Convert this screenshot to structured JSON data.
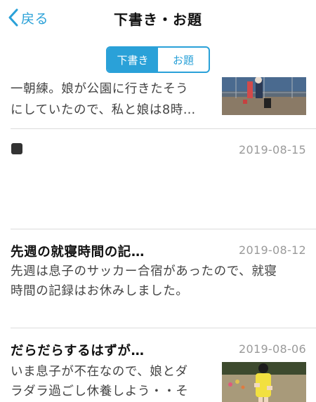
{
  "nav": {
    "back_label": "戻る",
    "title": "下書き・お題"
  },
  "segment": {
    "tabs": [
      "下書き",
      "お題"
    ],
    "selected": "下書き"
  },
  "list": [
    {
      "title": "",
      "date": "",
      "excerpt_lines": [
        "一朝練。娘が公園に行きたそう",
        "にしていたので、私と娘は8時…"
      ],
      "has_thumbnail": true
    },
    {
      "title": "",
      "date": "2019-08-15",
      "excerpt_lines": [],
      "icon": "black-square-icon"
    },
    {
      "title": "先週の就寝時間の記…",
      "date": "2019-08-12",
      "excerpt_lines": [
        "先週は息子のサッカー合宿があったので、就寝",
        "時間の記録はお休みしました。"
      ],
      "has_thumbnail": false
    },
    {
      "title": "だらだらするはずが…",
      "date": "2019-08-06",
      "excerpt_lines": [
        "いま息子が不在なので、娘とダ",
        "ラダラ過ごし休養しよう・・そ"
      ],
      "has_thumbnail": true
    }
  ],
  "colors": {
    "accent": "#2aa1d8",
    "date_text": "#9a9a9a",
    "divider": "#dcdcdc"
  }
}
